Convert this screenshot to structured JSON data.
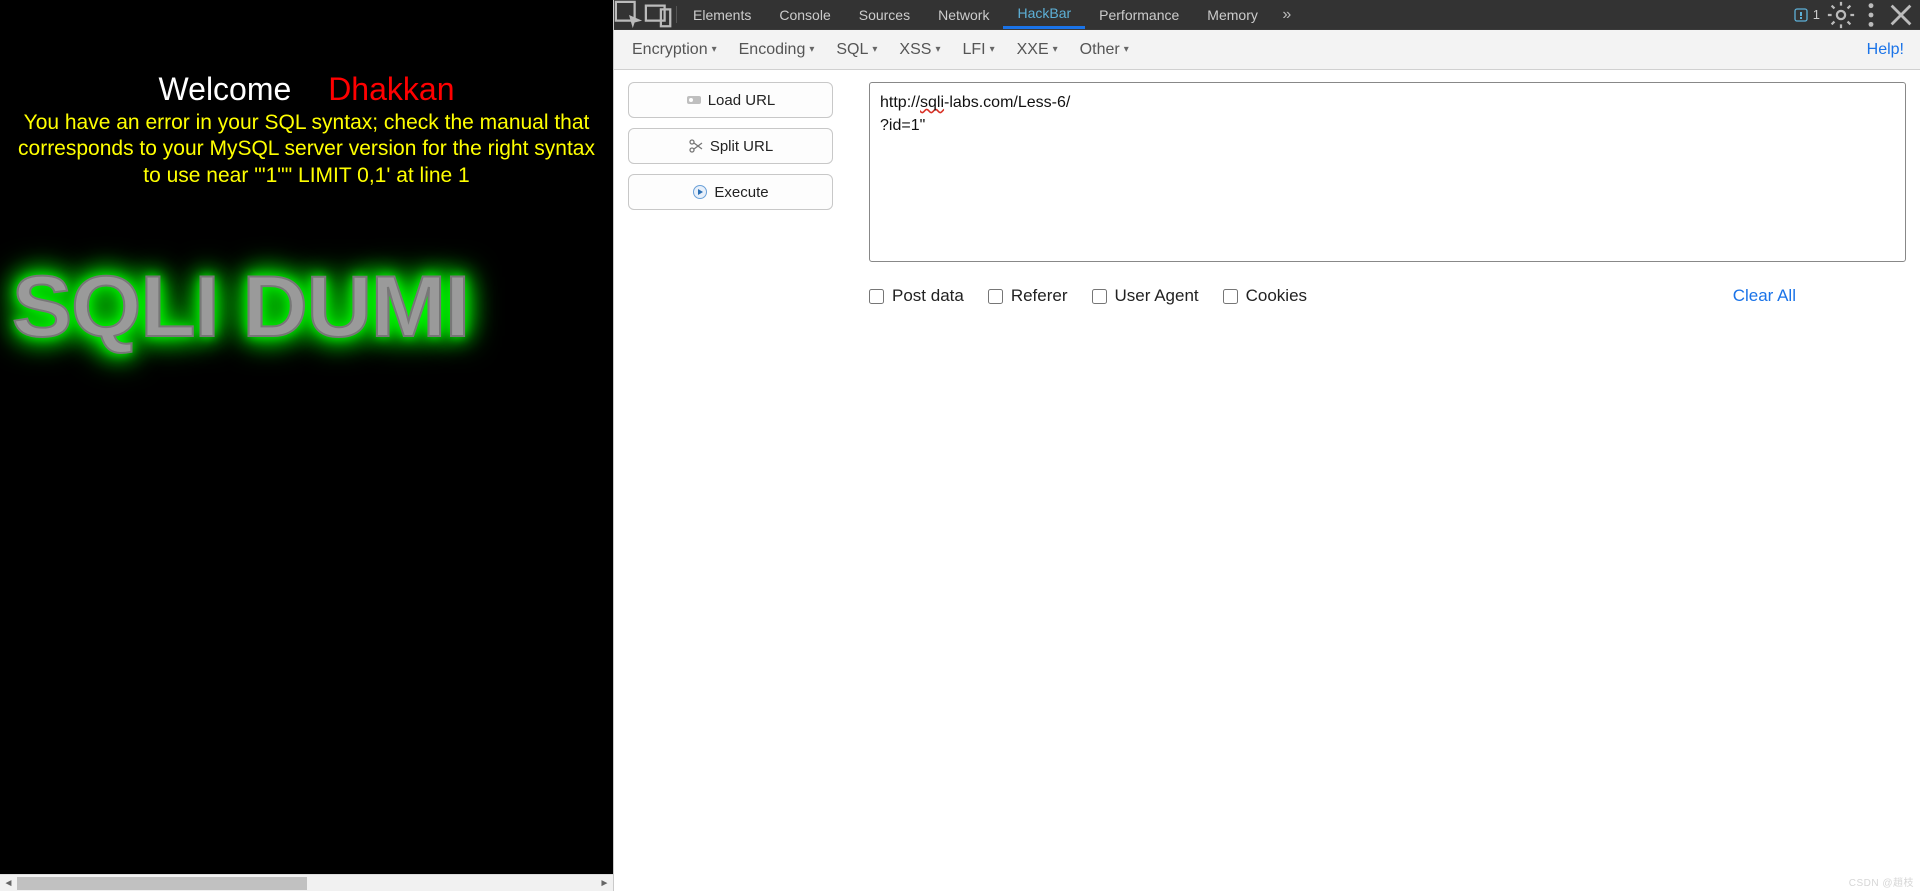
{
  "page": {
    "welcome": "Welcome",
    "dhakkan": "Dhakkan",
    "error": "You have an error in your SQL syntax; check the manual that corresponds to your MySQL server version for the right syntax to use near '\"1\"\" LIMIT 0,1' at line 1",
    "logo_text": "SQLI DUMI"
  },
  "devtools": {
    "tabs": [
      "Elements",
      "Console",
      "Sources",
      "Network",
      "HackBar",
      "Performance",
      "Memory"
    ],
    "active_tab": "HackBar",
    "issues_count": "1"
  },
  "hackbar": {
    "menus": [
      "Encryption",
      "Encoding",
      "SQL",
      "XSS",
      "LFI",
      "XXE",
      "Other"
    ],
    "help": "Help!",
    "buttons": {
      "load_url": "Load URL",
      "split_url": "Split URL",
      "execute": "Execute"
    },
    "url_line1": "http://",
    "url_spell": "sqli",
    "url_line1b": "-labs.com/Less-6/",
    "url_line2": "?id=1\"",
    "checks": {
      "post": "Post data",
      "referer": "Referer",
      "ua": "User Agent",
      "cookies": "Cookies"
    },
    "clear_all": "Clear All"
  },
  "watermark": "CSDN @趙枝"
}
